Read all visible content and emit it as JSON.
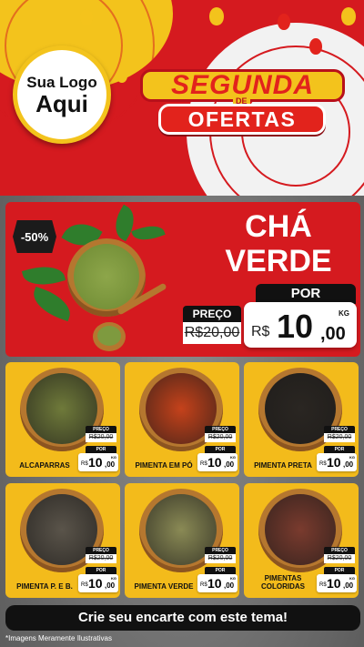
{
  "header": {
    "logo_line1": "Sua Logo",
    "logo_line2": "Aqui",
    "title_top": "SEGUNDA",
    "title_de": "DE",
    "title_bottom": "OFERTAS"
  },
  "colors": {
    "brand_red": "#d51a1f",
    "brand_yellow": "#f3c31c",
    "dark": "#111111"
  },
  "hero": {
    "discount": "-50%",
    "title_line1": "CHÁ",
    "title_line2": "VERDE",
    "old_label": "PREÇO",
    "old_prefix": "R$",
    "old_price": "20,00",
    "new_label": "POR",
    "currency": "R$",
    "price_int": "10",
    "price_dec": ",00",
    "unit": "KG"
  },
  "products": [
    {
      "name": "ALCAPARRAS",
      "old_label": "PREÇO",
      "old_price": "R$20,00",
      "new_label": "POR",
      "currency": "R$",
      "price_int": "10",
      "price_dec": ",00",
      "unit": "KG",
      "fill": "#6f7a3a"
    },
    {
      "name": "PIMENTA EM PÓ",
      "old_label": "PREÇO",
      "old_price": "R$20,00",
      "new_label": "POR",
      "currency": "R$",
      "price_int": "10",
      "price_dec": ",00",
      "unit": "KG",
      "fill": "#c5421b"
    },
    {
      "name": "PIMENTA PRETA",
      "old_label": "PREÇO",
      "old_price": "R$20,00",
      "new_label": "POR",
      "currency": "R$",
      "price_int": "10",
      "price_dec": ",00",
      "unit": "KG",
      "fill": "#2a2622"
    },
    {
      "name": "PIMENTA P. E B.",
      "old_label": "PREÇO",
      "old_price": "R$20,00",
      "new_label": "POR",
      "currency": "R$",
      "price_int": "10",
      "price_dec": ",00",
      "unit": "KG",
      "fill": "#5a544a"
    },
    {
      "name": "PIMENTA VERDE",
      "old_label": "PREÇO",
      "old_price": "R$20,00",
      "new_label": "POR",
      "currency": "R$",
      "price_int": "10",
      "price_dec": ",00",
      "unit": "KG",
      "fill": "#8a8a55"
    },
    {
      "name": "PIMENTAS COLORIDAS",
      "old_label": "PREÇO",
      "old_price": "R$20,00",
      "new_label": "POR",
      "currency": "R$",
      "price_int": "10",
      "price_dec": ",00",
      "unit": "KG",
      "fill": "#7a3b2e"
    }
  ],
  "footer": {
    "cta": "Crie seu encarte com este tema!",
    "note": "*Imagens Meramente Ilustrativas"
  }
}
